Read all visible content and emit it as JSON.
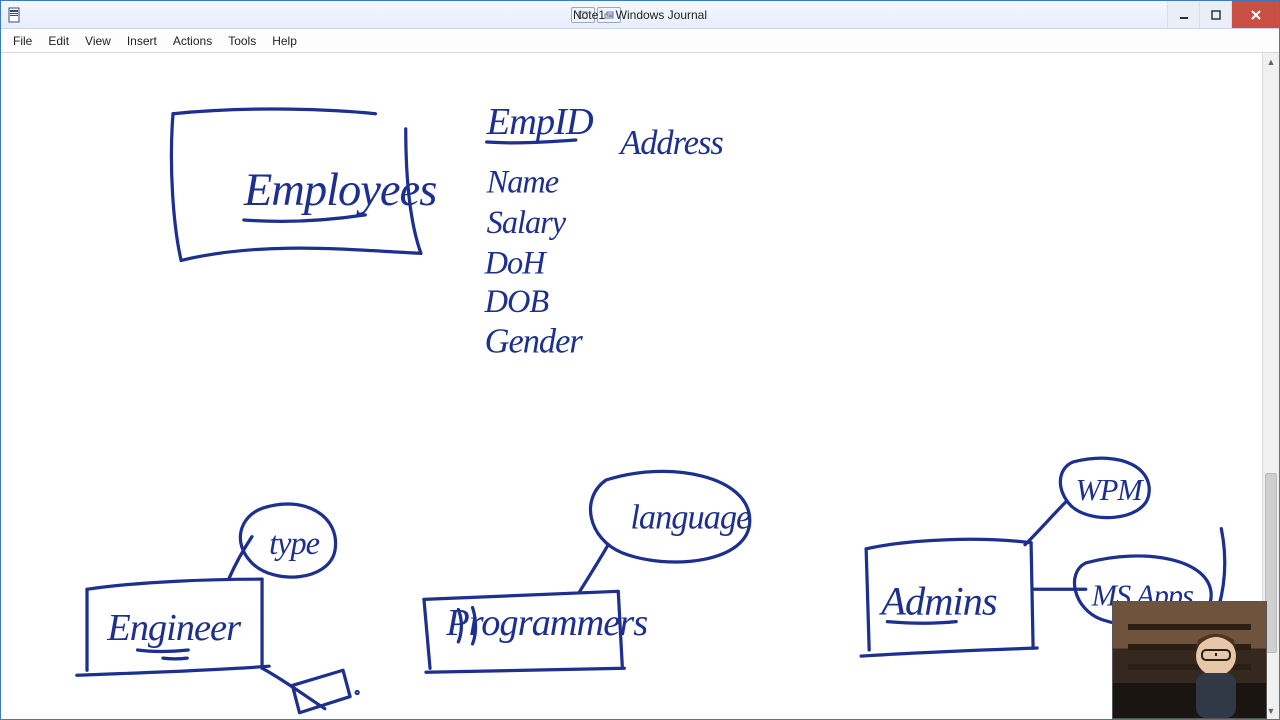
{
  "window": {
    "title": "Note1 - Windows Journal"
  },
  "menu": {
    "items": [
      {
        "label": "File"
      },
      {
        "label": "Edit"
      },
      {
        "label": "View"
      },
      {
        "label": "Insert"
      },
      {
        "label": "Actions"
      },
      {
        "label": "Tools"
      },
      {
        "label": "Help"
      }
    ]
  },
  "ink_color": "#1d2f8f",
  "handwriting": {
    "employees_box": "Employees",
    "attr_empid": "EmpID",
    "attr_address": "Address",
    "attr_name": "Name",
    "attr_salary": "Salary",
    "attr_doh": "DoH",
    "attr_dob": "DOB",
    "attr_gender": "Gender",
    "engineer_box": "Engineer",
    "engineer_bubble": "type",
    "programmers_box": "Programmers",
    "programmers_bubble": "language",
    "admins_box": "Admins",
    "admins_bubble1": "WPM",
    "admins_bubble2": "MS Apps."
  }
}
